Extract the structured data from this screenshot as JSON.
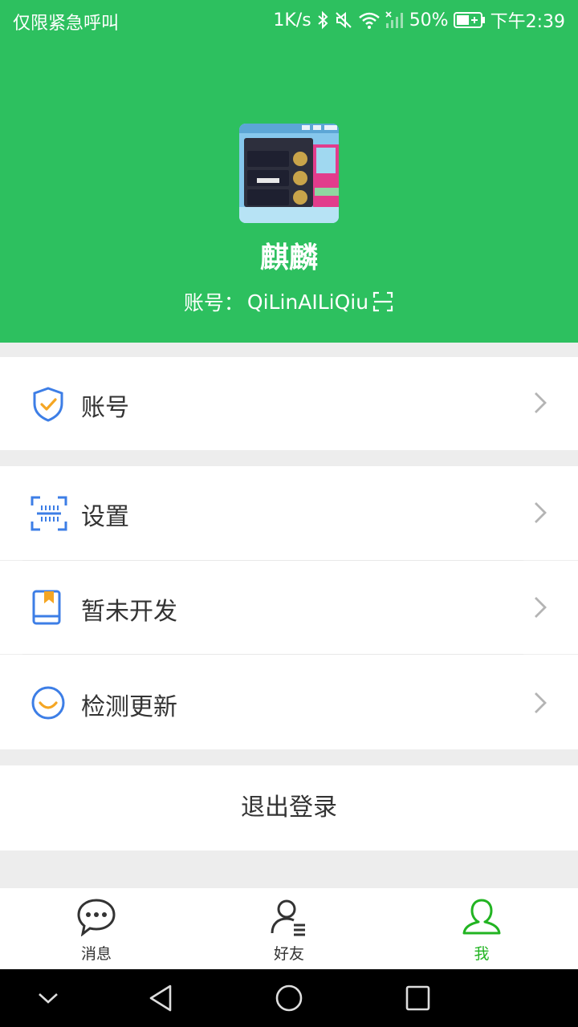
{
  "status_bar": {
    "carrier": "仅限紧急呼叫",
    "speed": "1K/s",
    "battery": "50%",
    "time": "下午2:39"
  },
  "profile": {
    "nickname": "麒麟",
    "account_prefix": "账号：",
    "account_id": "QiLinAILiQiu"
  },
  "menu": {
    "account": "账号",
    "settings": "设置",
    "not_developed": "暂未开发",
    "check_update": "检测更新"
  },
  "logout_label": "退出登录",
  "tabs": [
    {
      "label": "消息",
      "icon": "chat-bubble-icon"
    },
    {
      "label": "好友",
      "icon": "friends-icon"
    },
    {
      "label": "我",
      "icon": "person-icon"
    }
  ],
  "colors": {
    "brand_green": "#2dc05f",
    "active_tab": "#22b422",
    "icon_blue": "#3d7ee6",
    "icon_orange": "#f5a623"
  }
}
